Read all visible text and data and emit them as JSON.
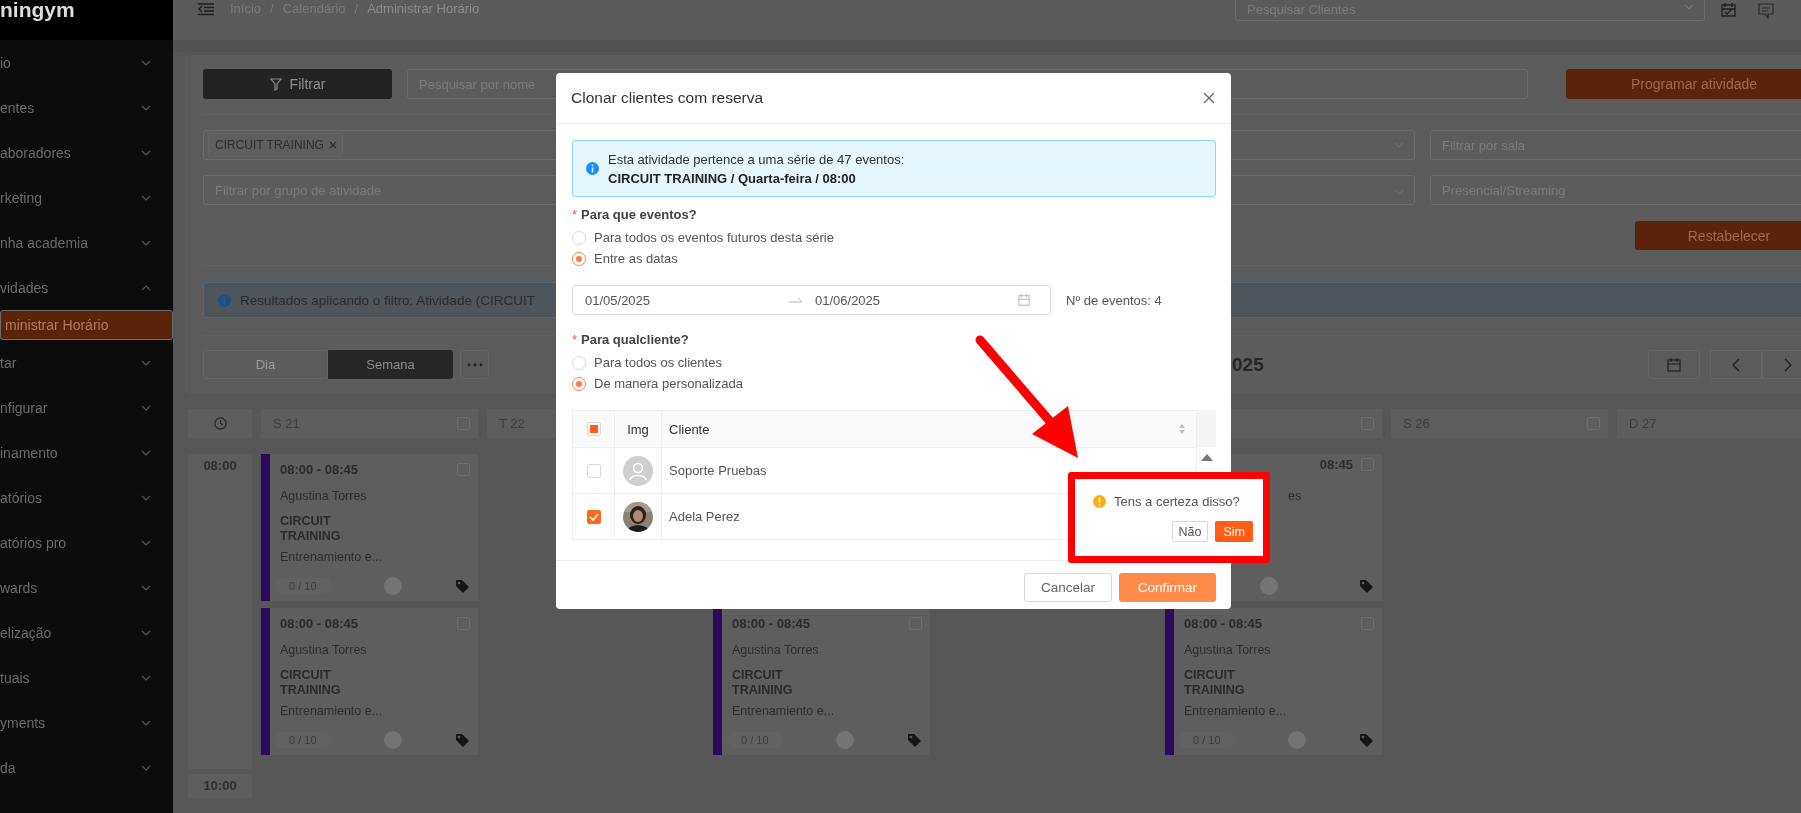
{
  "sidebar": {
    "logo": "ningym",
    "items": [
      {
        "label": "io",
        "expanded": false
      },
      {
        "label": "entes",
        "expanded": false
      },
      {
        "label": "aboradores",
        "expanded": false
      },
      {
        "label": "rketing",
        "expanded": false
      },
      {
        "label": "nha academia",
        "expanded": false
      },
      {
        "label": "vidades",
        "expanded": true,
        "children": [
          {
            "label": "ministrar Horário",
            "selected": true
          }
        ]
      },
      {
        "label": "tar",
        "expanded": false
      },
      {
        "label": "nfigurar",
        "expanded": false
      },
      {
        "label": "inamento",
        "expanded": false
      },
      {
        "label": "atórios",
        "expanded": false
      },
      {
        "label": "atórios pro",
        "expanded": false
      },
      {
        "label": "wards",
        "expanded": false
      },
      {
        "label": "elização",
        "expanded": false
      },
      {
        "label": "tuais",
        "expanded": false
      },
      {
        "label": "yments",
        "expanded": false
      },
      {
        "label": "da",
        "expanded": false
      }
    ]
  },
  "topbar": {
    "breadcrumb": [
      "Início",
      "Calendário",
      "Administrar Horário"
    ],
    "separator": "/",
    "search": {
      "placeholder": "Pesquisar Clientes"
    }
  },
  "filters": {
    "filter_button": "Filtrar",
    "search": {
      "placeholder": "Pesquisar por nome"
    },
    "program_button": "Programar atividade",
    "activity_tags": [
      "CIRCUIT TRAINING"
    ],
    "room": {
      "placeholder": "Filtrar por sala"
    },
    "group": {
      "placeholder": "Filtrar por grupo de atividade"
    },
    "mode": {
      "placeholder": "Presencial/Streaming"
    },
    "reset_button": "Restabelecer",
    "notice": "Resultados aplicando o filtro: Atividade (CIRCUIT"
  },
  "calendar": {
    "views": [
      {
        "label": "Dia",
        "selected": false
      },
      {
        "label": "Semana",
        "selected": true
      }
    ],
    "title": "025",
    "times": [
      "08:00",
      "10:00"
    ],
    "columns": [
      {
        "header": {
          "day": "S 21",
          "checked": false
        },
        "cards": [
          {
            "kind": "full",
            "time": "08:00 - 08:45",
            "trainer": "Agustina Torres",
            "activity": "CIRCUIT TRAINING",
            "description": "Entrenamiento e...",
            "capacity": "0 / 10",
            "checked": false
          },
          {
            "kind": "full",
            "time": "08:00 - 08:45",
            "trainer": "Agustina Torres",
            "activity": "CIRCUIT TRAINING",
            "description": "Entrenamiento e...",
            "capacity": "0 / 10",
            "checked": false
          }
        ]
      },
      {
        "header": {
          "day": "T 22"
        }
      },
      {
        "cards": [
          {
            "kind": "covered"
          },
          {
            "kind": "full",
            "time": "08:00 - 08:45",
            "trainer": "Agustina Torres",
            "activity": "CIRCUIT TRAINING",
            "description": "Entrenamiento e...",
            "capacity": "0 / 10",
            "checked": false
          }
        ]
      },
      {},
      {
        "header": {
          "checked": false
        },
        "cards": [
          {
            "kind": "partial",
            "time": "08:45",
            "trainer": "es",
            "checked": false
          },
          {
            "kind": "full",
            "time": "08:00 - 08:45",
            "trainer": "Agustina Torres",
            "activity": "CIRCUIT TRAINING",
            "description": "Entrenamiento e...",
            "capacity": "0 / 10",
            "checked": false
          }
        ]
      },
      {
        "header": {
          "day": "S 26",
          "checked": false
        }
      },
      {
        "header": {
          "day": "D 27"
        }
      }
    ]
  },
  "modal": {
    "title": "Clonar clientes com reserva",
    "notice": {
      "text": "Esta atividade pertence a uma série de 47 eventos:",
      "series": "CIRCUIT TRAINING / Quarta-feira / 08:00"
    },
    "events_question": {
      "mark": "*",
      "label": "Para que eventos?",
      "options": [
        {
          "label": "Para todos os eventos futuros desta série",
          "selected": false
        },
        {
          "label": "Entre as datas",
          "selected": true
        }
      ]
    },
    "date_range": {
      "start": "01/05/2025",
      "end": "01/06/2025"
    },
    "event_count": "Nº de eventos: 4",
    "clients_question": {
      "mark": "*",
      "label": "Para qualcliente?",
      "options": [
        {
          "label": "Para todos os clientes",
          "selected": false
        },
        {
          "label": "De manera personalizada",
          "selected": true
        }
      ]
    },
    "table": {
      "select_all_indeterminate": true,
      "columns": [
        "Img",
        "Cliente"
      ],
      "rows": [
        {
          "name": "Soporte Pruebas",
          "checked": false,
          "kind": "default"
        },
        {
          "name": "Adela Perez",
          "checked": true
        }
      ]
    },
    "cancel_button": "Cancelar",
    "confirm_button": "Confirmar"
  },
  "popconfirm": {
    "message": "Tens a certeza disso?",
    "cancel": "Não",
    "ok": "Sim"
  }
}
